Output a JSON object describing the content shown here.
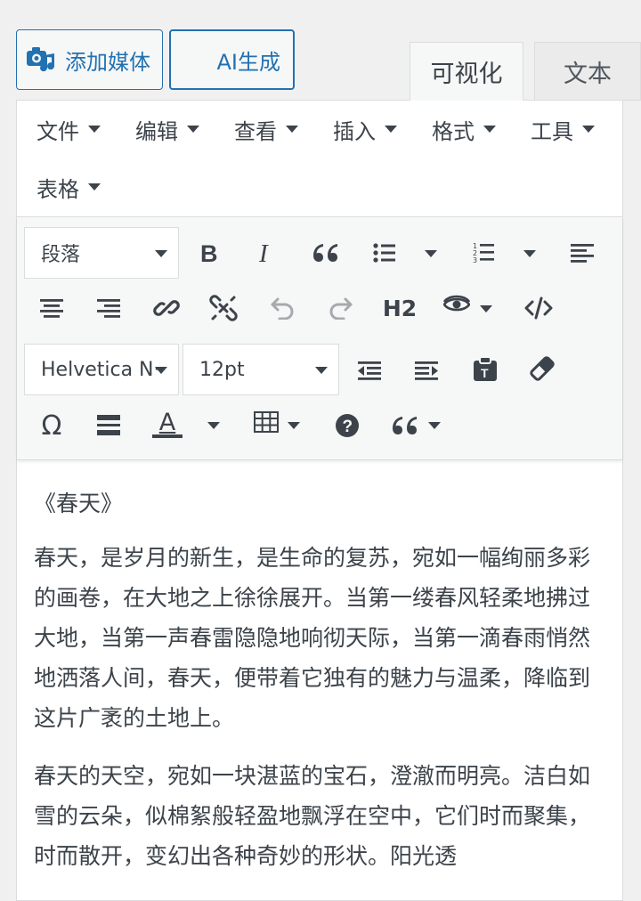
{
  "buttons": {
    "add_media": "添加媒体",
    "ai_generate": "AI生成"
  },
  "tabs": {
    "visual": "可视化",
    "text": "文本"
  },
  "menu": {
    "file": "文件",
    "edit": "编辑",
    "view": "查看",
    "insert": "插入",
    "format": "格式",
    "tools": "工具",
    "table": "表格"
  },
  "toolbar": {
    "paragraph_select": "段落",
    "heading_h2": "H2",
    "font_family_select": "Helvetica N··",
    "font_size_select": "12pt",
    "omega": "Ω",
    "text_color": "A"
  },
  "content": {
    "title": "《春天》",
    "paragraph1": "春天，是岁月的新生，是生命的复苏，宛如一幅绚丽多彩的画卷，在大地之上徐徐展开。当第一缕春风轻柔地拂过大地，当第一声春雷隐隐地响彻天际，当第一滴春雨悄然地洒落人间，春天，便带着它独有的魅力与温柔，降临到这片广袤的土地上。",
    "paragraph2": "春天的天空，宛如一块湛蓝的宝石，澄澈而明亮。洁白如雪的云朵，似棉絮般轻盈地飘浮在空中，它们时而聚集，时而散开，变幻出各种奇妙的形状。阳光透"
  },
  "colors": {
    "accent": "#2271b1",
    "toolbar_bg": "#f6f7f7",
    "page_bg": "#f0f0f1"
  }
}
